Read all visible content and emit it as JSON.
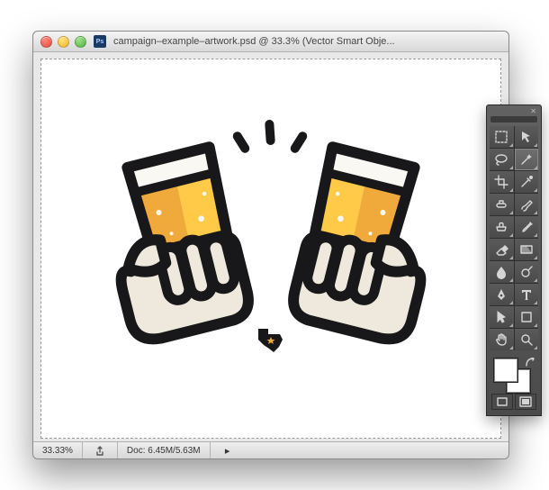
{
  "window": {
    "title": "campaign–example–artwork.psd @ 33.3% (Vector Smart Obje..."
  },
  "statusbar": {
    "zoom": "33.33%",
    "doc_label": "Doc: 6.45M/5.63M"
  },
  "tools": [
    {
      "name": "marquee-tool"
    },
    {
      "name": "move-tool"
    },
    {
      "name": "lasso-tool"
    },
    {
      "name": "magic-wand-tool",
      "selected": true
    },
    {
      "name": "crop-tool"
    },
    {
      "name": "eyedropper-tool"
    },
    {
      "name": "spot-healing-tool"
    },
    {
      "name": "brush-tool"
    },
    {
      "name": "clone-stamp-tool"
    },
    {
      "name": "history-brush-tool"
    },
    {
      "name": "eraser-tool"
    },
    {
      "name": "gradient-tool"
    },
    {
      "name": "blur-tool"
    },
    {
      "name": "dodge-tool"
    },
    {
      "name": "pen-tool"
    },
    {
      "name": "type-tool"
    },
    {
      "name": "path-selection-tool"
    },
    {
      "name": "shape-tool"
    },
    {
      "name": "hand-tool"
    },
    {
      "name": "zoom-tool"
    }
  ],
  "colors": {
    "outline": "#18181A",
    "beer_light": "#FECA47",
    "beer_dark": "#F0A93B",
    "foam": "#FAF8F2",
    "hand": "#EEE9DC",
    "hand_shadow": "#D8D1BF"
  }
}
